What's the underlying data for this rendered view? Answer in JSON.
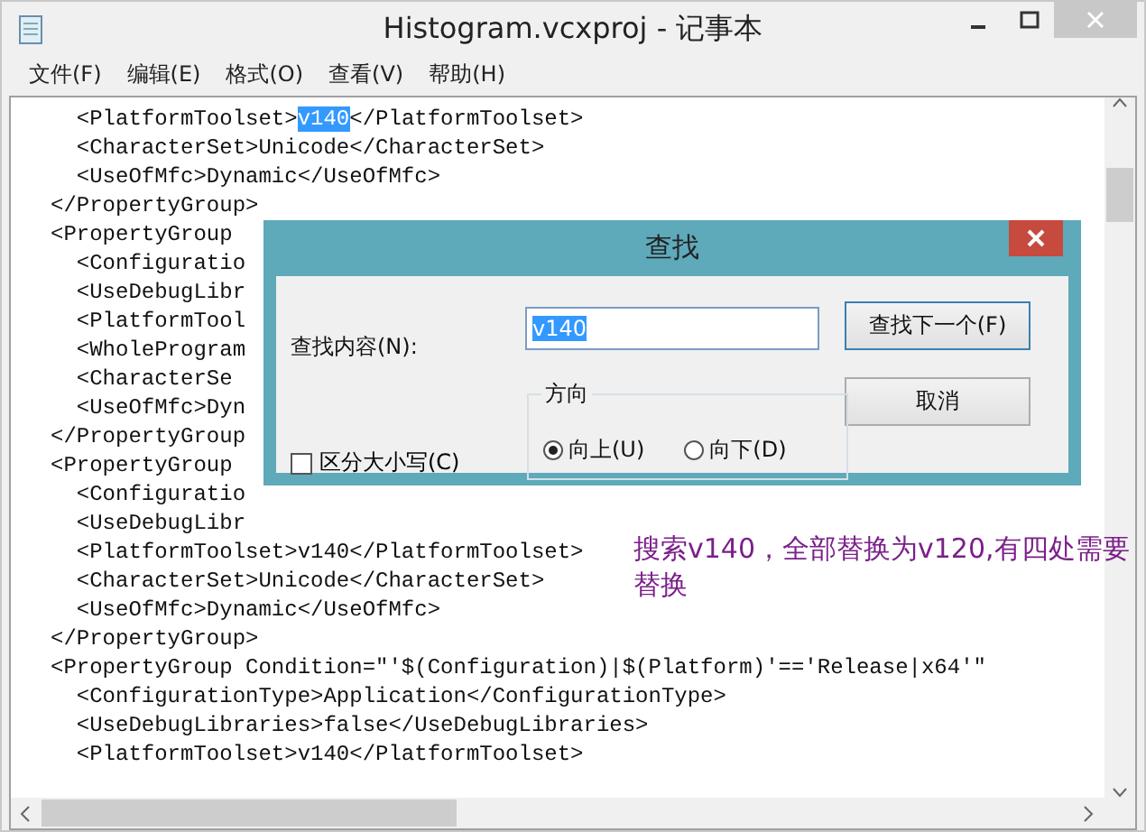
{
  "window": {
    "title": "Histogram.vcxproj - 记事本"
  },
  "menu": [
    "文件(F)",
    "编辑(E)",
    "格式(O)",
    "查看(V)",
    "帮助(H)"
  ],
  "editor": {
    "lines": [
      {
        "text": "  <PlatformToolset>",
        "highlight": "v140",
        "after": "</PlatformToolset>"
      },
      {
        "text": "  <CharacterSet>Unicode</CharacterSet>"
      },
      {
        "text": "  <UseOfMfc>Dynamic</UseOfMfc>"
      },
      {
        "text": "</PropertyGroup>"
      },
      {
        "text": "<PropertyGroup"
      },
      {
        "text": "  <Configuratio"
      },
      {
        "text": "  <UseDebugLibr"
      },
      {
        "text": "  <PlatformTool"
      },
      {
        "text": "  <WholeProgram"
      },
      {
        "text": "  <CharacterSe"
      },
      {
        "text": "  <UseOfMfc>Dyn"
      },
      {
        "text": "</PropertyGroup"
      },
      {
        "text": "<PropertyGroup"
      },
      {
        "text": "  <Configuratio"
      },
      {
        "text": "  <UseDebugLibr"
      },
      {
        "text": "  <PlatformToolset>v140</PlatformToolset>"
      },
      {
        "text": "  <CharacterSet>Unicode</CharacterSet>"
      },
      {
        "text": "  <UseOfMfc>Dynamic</UseOfMfc>"
      },
      {
        "text": "</PropertyGroup>"
      },
      {
        "text": "<PropertyGroup Condition=\"'$(Configuration)|$(Platform)'=='Release|x64'\""
      },
      {
        "text": "  <ConfigurationType>Application</ConfigurationType>"
      },
      {
        "text": "  <UseDebugLibraries>false</UseDebugLibraries>"
      },
      {
        "text": "  <PlatformToolset>v140</PlatformToolset>"
      }
    ]
  },
  "annotation": "搜索v140，全部替换为v120,有四处需要替换",
  "find_dialog": {
    "title": "查找",
    "find_label": "查找内容(N):",
    "find_value": "v140",
    "find_next_button": "查找下一个(F)",
    "cancel_button": "取消",
    "match_case": {
      "label": "区分大小写(C)",
      "checked": false
    },
    "direction": {
      "label": "方向",
      "options": [
        {
          "label": "向上(U)",
          "selected": true
        },
        {
          "label": "向下(D)",
          "selected": false
        }
      ]
    }
  }
}
